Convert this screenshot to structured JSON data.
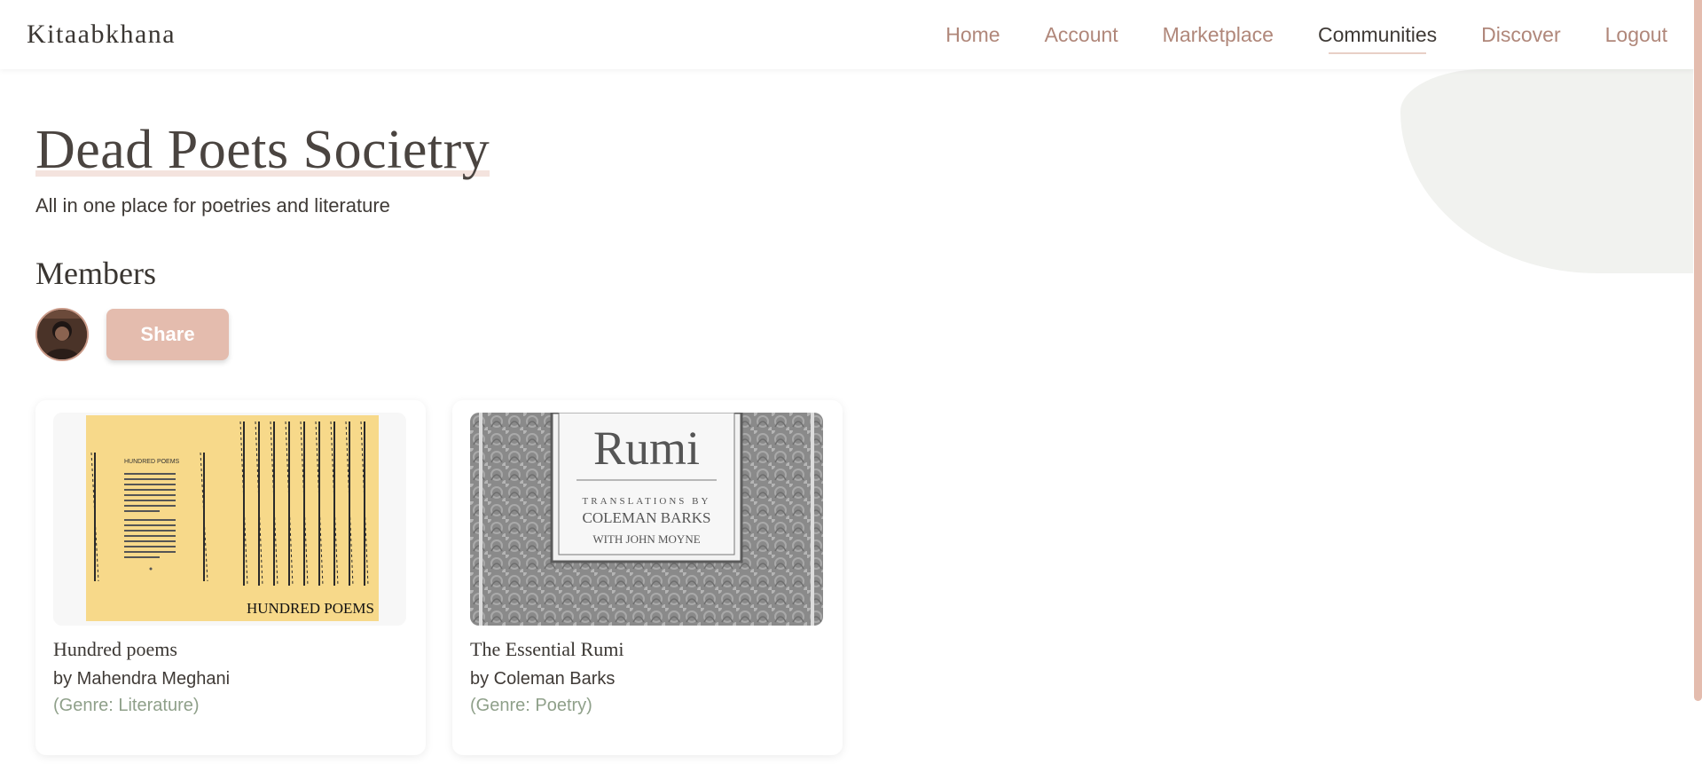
{
  "header": {
    "brand": "Kitaabkhana",
    "nav": [
      {
        "label": "Home",
        "active": false
      },
      {
        "label": "Account",
        "active": false
      },
      {
        "label": "Marketplace",
        "active": false
      },
      {
        "label": "Communities",
        "active": true
      },
      {
        "label": "Discover",
        "active": false
      },
      {
        "label": "Logout",
        "active": false
      }
    ]
  },
  "community": {
    "title": "Dead Poets Societry",
    "subtitle": "All in one place for poetries and literature"
  },
  "members": {
    "heading": "Members",
    "share_label": "Share"
  },
  "books": [
    {
      "title": "Hundred poems",
      "author": "by Mahendra Meghani",
      "genre": "(Genre: Literature)",
      "cover": {
        "heading": "HUNDRED POEMS",
        "footer": "HUNDRED POEMS",
        "bg_color": "#f7d98a"
      }
    },
    {
      "title": "The Essential Rumi",
      "author": "by Coleman Barks",
      "genre": "(Genre: Poetry)",
      "cover": {
        "title": "Rumi",
        "line1": "TRANSLATIONS BY",
        "line2": "COLEMAN BARKS",
        "line3": "WITH JOHN MOYNE"
      }
    }
  ],
  "colors": {
    "accent": "#e4bcae",
    "nav_inactive": "#b0877a",
    "genre": "#8fa08a"
  }
}
